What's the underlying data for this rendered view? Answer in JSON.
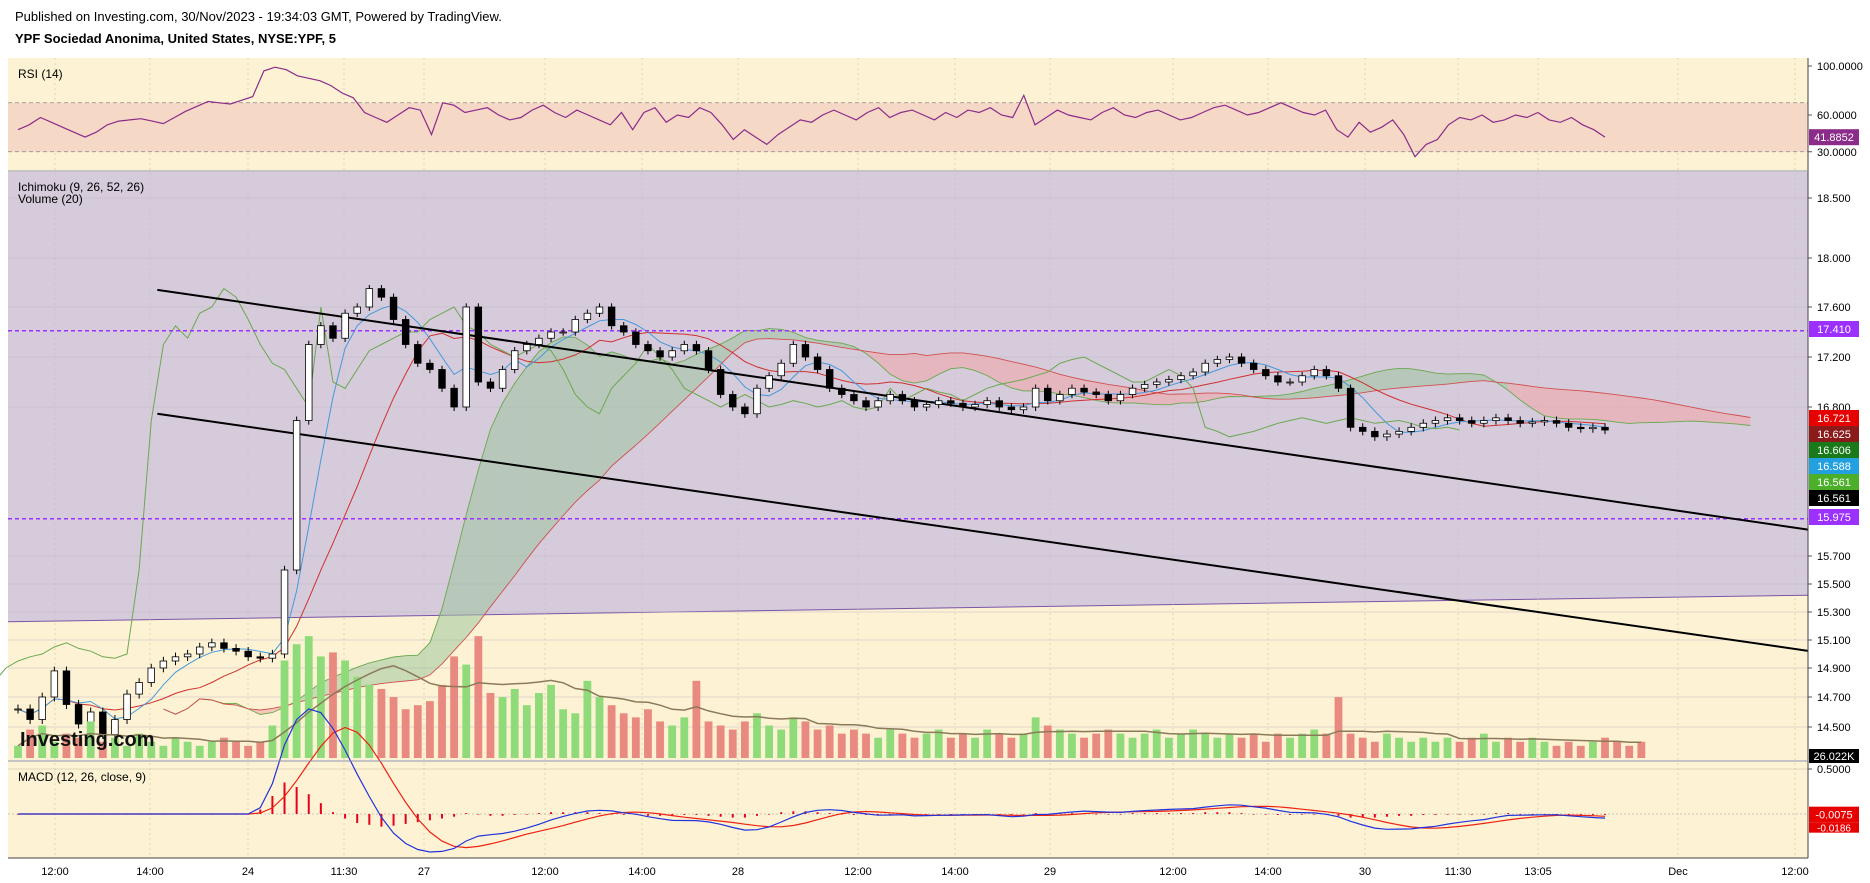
{
  "header": {
    "published": "Published on Investing.com, 30/Nov/2023 - 19:34:03 GMT, Powered by TradingView.",
    "symbol_line": "YPF Sociedad Anonima, United States, NYSE:YPF, 5"
  },
  "watermark": "Investing.com",
  "colors": {
    "background": "#fdf3d4",
    "range_box": "#d6cbdb",
    "candle": "#000000",
    "vol_up": "#8fdb7a",
    "vol_down": "#e98a80",
    "rsi_line": "#8b2b8a",
    "rsi_band": "#f6d8c6",
    "macd_line": "#2233dd",
    "signal_line": "#ee2211",
    "hist": "#e6001a",
    "hline": "#9b30ff",
    "kijun": "#d03030",
    "tenkan": "#4499dd",
    "chikou": "#6aa84f",
    "cloud_bull": "#9fc49f",
    "cloud_bear": "#f3a6a6",
    "vol_ma": "#8a7a5a"
  },
  "panes": {
    "rsi": {
      "label": "RSI (14)",
      "ticks": [
        "100.0000",
        "60.0000",
        "30.0000"
      ],
      "last": "41.8852",
      "series": [
        48,
        52,
        58,
        54,
        50,
        46,
        42,
        46,
        52,
        55,
        56,
        57,
        55,
        53,
        58,
        63,
        67,
        71,
        70,
        69,
        72,
        75,
        96,
        99,
        97,
        92,
        90,
        88,
        84,
        78,
        74,
        62,
        58,
        54,
        60,
        66,
        64,
        44,
        70,
        68,
        62,
        64,
        66,
        60,
        56,
        58,
        64,
        68,
        62,
        58,
        64,
        60,
        56,
        52,
        62,
        48,
        62,
        66,
        54,
        60,
        58,
        66,
        62,
        52,
        40,
        48,
        42,
        36,
        44,
        50,
        56,
        54,
        60,
        64,
        60,
        56,
        62,
        66,
        58,
        62,
        64,
        60,
        56,
        62,
        58,
        64,
        62,
        66,
        60,
        58,
        76,
        52,
        58,
        64,
        60,
        58,
        56,
        62,
        66,
        60,
        58,
        62,
        64,
        60,
        56,
        58,
        62,
        66,
        68,
        64,
        60,
        62,
        66,
        70,
        66,
        62,
        60,
        64,
        48,
        42,
        54,
        46,
        50,
        56,
        44,
        26,
        36,
        40,
        52,
        58,
        56,
        60,
        54,
        56,
        60,
        58,
        62,
        56,
        54,
        58,
        52,
        48,
        42
      ],
      "tick_values": [
        100,
        60,
        30
      ],
      "last_value": 41.8852
    },
    "main": {
      "label_ichimoku": "Ichimoku (9, 26, 52, 26)",
      "label_volume": "Volume (20)",
      "price_ticks": [
        "18.500",
        "18.000",
        "17.600",
        "17.200",
        "16.800",
        "15.700",
        "15.500",
        "15.300",
        "15.100",
        "14.900",
        "14.700",
        "14.500"
      ],
      "markers": [
        {
          "label": "17.410",
          "color": "#9b30ff"
        },
        {
          "label": "16.721",
          "color": "#e60000"
        },
        {
          "label": "16.625",
          "color": "#8b1a1a"
        },
        {
          "label": "16.606",
          "color": "#1a7a1a"
        },
        {
          "label": "16.588",
          "color": "#22a0e0"
        },
        {
          "label": "16.561",
          "color": "#4caf2a"
        },
        {
          "label": "16.561",
          "color": "#000000"
        },
        {
          "label": "15.975",
          "color": "#9b30ff"
        }
      ],
      "volume_last": "26.022K",
      "horizontal_levels": [
        17.41,
        15.975
      ],
      "channel_upper": [
        [
          11.5,
          17.74
        ],
        [
          66,
          16.97
        ]
      ],
      "channel_lower": [
        [
          11.5,
          16.75
        ],
        [
          66,
          16.05
        ]
      ]
    },
    "macd": {
      "label": "MACD (12, 26, close, 9)",
      "ticks": [
        "0.5000"
      ],
      "last": "-0.0075",
      "last2": "-0.0186",
      "tick_values": [
        0.5
      ],
      "last_value": -0.0075,
      "last2_value": -0.0186
    }
  },
  "time_axis": [
    "12:00",
    "14:00",
    "24",
    "11:30",
    "27",
    "12:00",
    "14:00",
    "28",
    "12:00",
    "14:00",
    "29",
    "12:00",
    "14:00",
    "30",
    "11:30",
    "13:05",
    "Dec",
    "12:00"
  ],
  "chart_data": {
    "type": "candlestick",
    "price_axis": {
      "ylim": [
        14.3,
        18.65
      ]
    },
    "close": [
      14.62,
      14.55,
      14.7,
      14.88,
      14.65,
      14.52,
      14.6,
      14.45,
      14.55,
      14.72,
      14.8,
      14.9,
      14.95,
      14.98,
      15.0,
      15.05,
      15.08,
      15.04,
      15.02,
      14.98,
      14.97,
      15.0,
      15.6,
      16.7,
      17.3,
      17.45,
      17.35,
      17.55,
      17.6,
      17.75,
      17.68,
      17.5,
      17.3,
      17.15,
      17.1,
      16.95,
      16.8,
      17.6,
      17.0,
      16.95,
      17.1,
      17.25,
      17.3,
      17.35,
      17.4,
      17.4,
      17.5,
      17.55,
      17.6,
      17.45,
      17.4,
      17.3,
      17.25,
      17.2,
      17.25,
      17.3,
      17.25,
      17.1,
      16.9,
      16.8,
      16.75,
      16.95,
      17.05,
      17.15,
      17.3,
      17.2,
      17.1,
      16.95,
      16.9,
      16.85,
      16.8,
      16.85,
      16.9,
      16.85,
      16.8,
      16.82,
      16.85,
      16.83,
      16.8,
      16.82,
      16.85,
      16.8,
      16.78,
      16.8,
      16.95,
      16.85,
      16.9,
      16.95,
      16.92,
      16.9,
      16.85,
      16.9,
      16.95,
      16.98,
      17.0,
      17.02,
      17.05,
      17.08,
      17.15,
      17.18,
      17.2,
      17.15,
      17.1,
      17.05,
      17.0,
      17.0,
      17.05,
      17.1,
      17.05,
      16.95,
      16.65,
      16.62,
      16.58,
      16.6,
      16.62,
      16.65,
      16.68,
      16.7,
      16.72,
      16.7,
      16.68,
      16.7,
      16.72,
      16.7,
      16.68,
      16.69,
      16.7,
      16.68,
      16.65,
      16.64,
      16.65,
      16.63
    ],
    "volume": [
      30,
      70,
      80,
      40,
      60,
      50,
      90,
      40,
      50,
      30,
      60,
      40,
      30,
      50,
      40,
      30,
      40,
      50,
      40,
      30,
      40,
      80,
      240,
      280,
      300,
      250,
      260,
      240,
      200,
      180,
      170,
      150,
      120,
      130,
      140,
      180,
      250,
      230,
      300,
      160,
      150,
      170,
      130,
      160,
      180,
      120,
      110,
      190,
      150,
      130,
      110,
      100,
      120,
      90,
      80,
      100,
      190,
      90,
      80,
      70,
      90,
      110,
      80,
      70,
      100,
      90,
      70,
      80,
      60,
      70,
      60,
      50,
      70,
      60,
      50,
      60,
      70,
      50,
      60,
      50,
      70,
      60,
      50,
      60,
      100,
      80,
      70,
      60,
      50,
      60,
      70,
      60,
      50,
      60,
      70,
      50,
      60,
      70,
      60,
      50,
      60,
      50,
      60,
      40,
      60,
      50,
      60,
      70,
      60,
      150,
      60,
      50,
      40,
      60,
      50,
      40,
      50,
      40,
      50,
      40,
      50,
      60,
      40,
      50,
      40,
      50,
      40,
      30,
      40,
      30,
      40,
      50,
      40,
      30,
      40
    ],
    "macd_hist": [
      0,
      0,
      0,
      0,
      0,
      0,
      0,
      0,
      0,
      0,
      0,
      0,
      0,
      0,
      0,
      0,
      0,
      0,
      0,
      0,
      0.05,
      0.2,
      0.35,
      0.3,
      0.22,
      0.12,
      0.02,
      -0.05,
      -0.1,
      -0.12,
      -0.14,
      -0.13,
      -0.11,
      -0.09,
      -0.07,
      -0.05,
      -0.03,
      0.01,
      0.0,
      -0.02,
      -0.02,
      -0.01,
      0.0,
      0.01,
      0.02,
      0.02,
      0.02,
      0.02,
      0.01,
      0.0,
      -0.01,
      -0.01,
      -0.02,
      -0.02,
      -0.02,
      -0.01,
      -0.01,
      -0.02,
      -0.03,
      -0.04,
      -0.04,
      -0.02,
      0.0,
      0.02,
      0.03,
      0.03,
      0.02,
      0.01,
      0.0,
      -0.01,
      -0.01,
      -0.01,
      0.0,
      0.0,
      -0.01,
      0.0,
      0.0,
      0.0,
      0.0,
      0.0,
      0.0,
      -0.01,
      -0.01,
      0.0,
      0.01,
      0.0,
      0.01,
      0.01,
      0.01,
      0.0,
      0.0,
      0.0,
      0.01,
      0.01,
      0.01,
      0.01,
      0.01,
      0.01,
      0.02,
      0.02,
      0.02,
      0.01,
      0.0,
      0.0,
      -0.01,
      -0.01,
      0.0,
      0.0,
      -0.01,
      -0.02,
      -0.04,
      -0.04,
      -0.04,
      -0.03,
      -0.02,
      -0.02,
      -0.01,
      -0.01,
      0.0,
      0.0,
      0.0,
      0.0,
      0.01,
      0.01,
      0.0,
      0.0,
      0.0,
      0.0,
      -0.01,
      -0.01,
      -0.01,
      -0.01
    ]
  }
}
